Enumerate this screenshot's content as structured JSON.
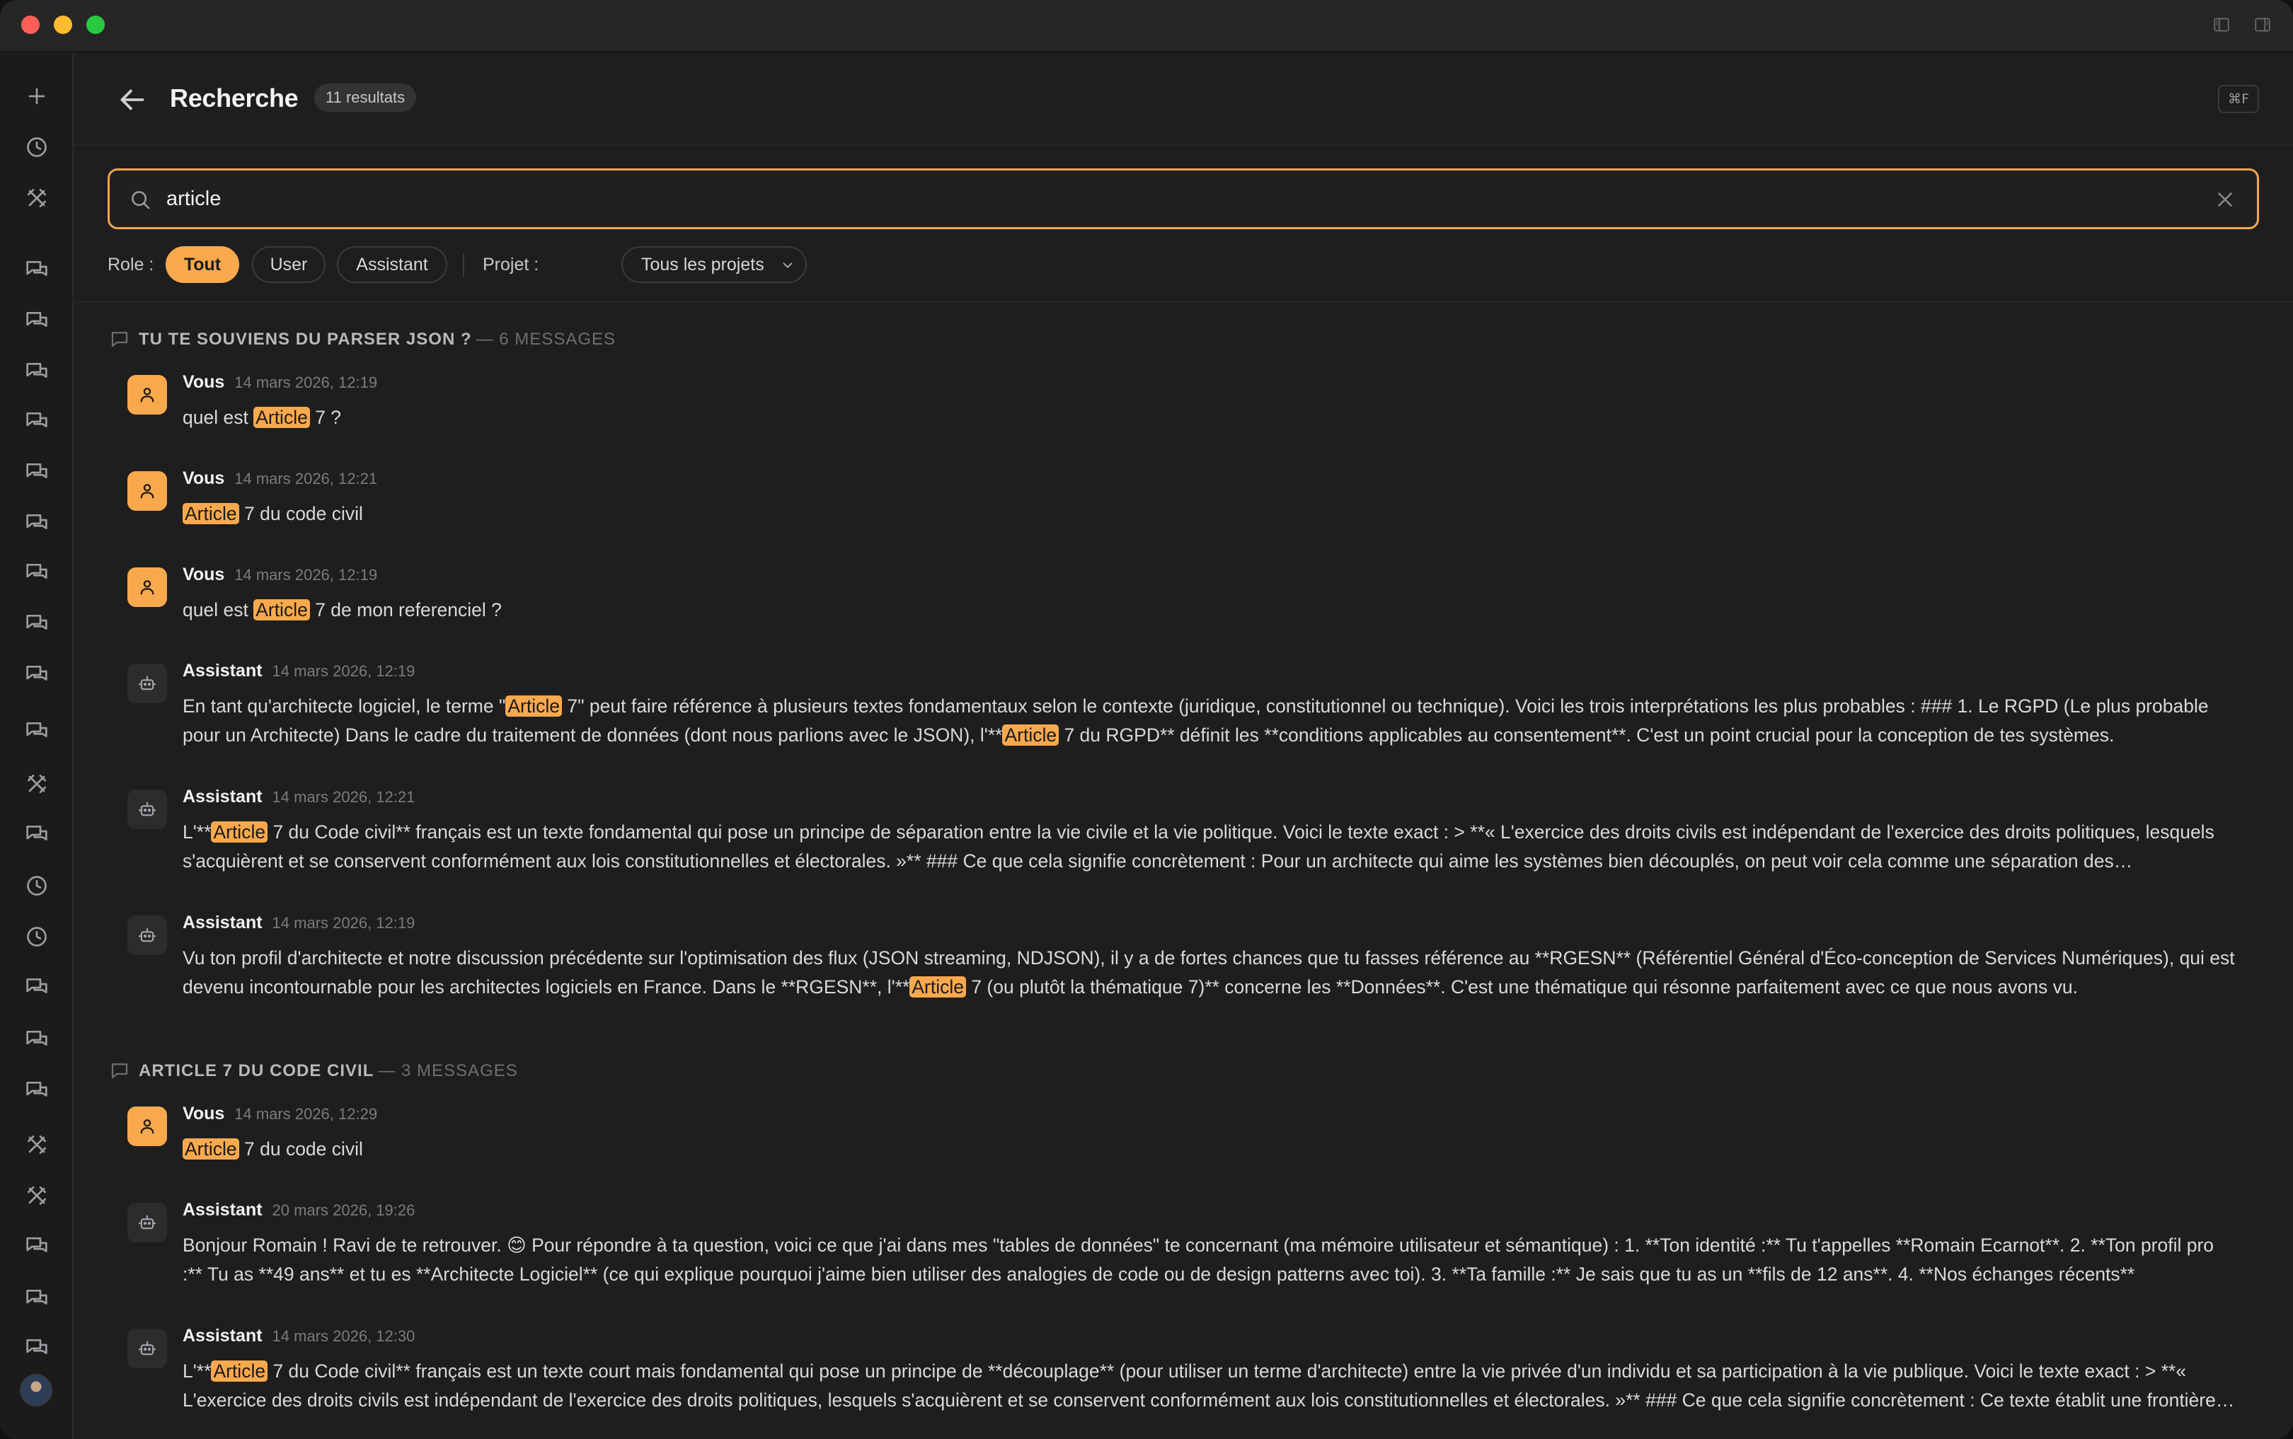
{
  "colors": {
    "accent": "#f8a94e",
    "background": "#1e1e1f",
    "highlight_text": "#1b1b1c"
  },
  "header": {
    "title": "Recherche",
    "result_count": "11 resultats",
    "shortcut": "⌘F"
  },
  "search": {
    "value": "article",
    "placeholder": ""
  },
  "filters": {
    "role_label": "Role :",
    "roles": [
      "Tout",
      "User",
      "Assistant"
    ],
    "active_role": "Tout",
    "project_label": "Projet :",
    "project_value": "Tous les projets"
  },
  "rail_icons": [
    "plus-icon",
    "clock-icon",
    "tools-icon",
    "chat-icon",
    "chat-icon",
    "chat-icon",
    "chat-icon",
    "chat-icon",
    "chat-icon",
    "chat-icon",
    "chat-icon",
    "chat-icon",
    "chat-icon",
    "tools-icon",
    "chat-icon",
    "clock-icon",
    "clock-icon",
    "chat-icon",
    "chat-icon",
    "chat-icon",
    "tools-icon",
    "tools-icon",
    "chat-icon",
    "chat-icon",
    "chat-icon"
  ],
  "groups": [
    {
      "title": "TU TE SOUVIENS DU PARSER JSON ?",
      "count": "— 6 MESSAGES",
      "messages": [
        {
          "role": "Vous",
          "date": "14 mars 2026, 12:19",
          "parts": [
            "quel est ",
            "Article",
            " 7 ?"
          ]
        },
        {
          "role": "Vous",
          "date": "14 mars 2026, 12:21",
          "parts": [
            "",
            "Article",
            " 7 du code civil"
          ]
        },
        {
          "role": "Vous",
          "date": "14 mars 2026, 12:19",
          "parts": [
            "quel est ",
            "Article",
            " 7 de mon referenciel ?"
          ]
        },
        {
          "role": "Assistant",
          "date": "14 mars 2026, 12:19",
          "parts": [
            "En tant qu'architecte logiciel, le terme \"",
            "Article",
            " 7\" peut faire référence à plusieurs textes fondamentaux selon le contexte (juridique, constitutionnel ou technique). Voici les trois interprétations les plus probables : ### 1. Le RGPD (Le plus probable pour un Architecte) Dans le cadre du traitement de données (dont nous parlions avec le JSON), l'**",
            "Article",
            " 7 du RGPD** définit les **conditions applicables au consentement**. C'est un point crucial pour la conception de tes systèmes."
          ]
        },
        {
          "role": "Assistant",
          "date": "14 mars 2026, 12:21",
          "parts": [
            "L'**",
            "Article",
            " 7 du Code civil** français est un texte fondamental qui pose un principe de séparation entre la vie civile et la vie politique. Voici le texte exact : > **« L'exercice des droits civils est indépendant de l'exercice des droits politiques, lesquels s'acquièrent et se conservent conformément aux lois constitutionnelles et électorales. »** ### Ce que cela signifie concrètement : Pour un architecte qui aime les systèmes bien découplés, on peut voir cela comme une séparation des responsabilités."
          ]
        },
        {
          "role": "Assistant",
          "date": "14 mars 2026, 12:19",
          "parts": [
            "Vu ton profil d'architecte et notre discussion précédente sur l'optimisation des flux (JSON streaming, NDJSON), il y a de fortes chances que tu fasses référence au **RGESN** (Référentiel Général d'Éco-conception de Services Numériques), qui est devenu incontournable pour les architectes logiciels en France. Dans le **RGESN**, l'**",
            "Article",
            " 7 (ou plutôt la thématique 7)** concerne les **Données**. C'est une thématique qui résonne parfaitement avec ce que nous avons vu."
          ]
        }
      ]
    },
    {
      "title": "ARTICLE 7 DU CODE CIVIL",
      "count": "— 3 MESSAGES",
      "messages": [
        {
          "role": "Vous",
          "date": "14 mars 2026, 12:29",
          "parts": [
            "",
            "Article",
            " 7 du code civil"
          ]
        },
        {
          "role": "Assistant",
          "date": "20 mars 2026, 19:26",
          "parts": [
            "Bonjour Romain ! Ravi de te retrouver. 😊 Pour répondre à ta question, voici ce que j'ai dans mes \"tables de données\" te concernant (ma mémoire utilisateur et sémantique) : 1. **Ton identité :** Tu t'appelles **Romain Ecarnot**. 2. **Ton profil pro :** Tu as **49 ans** et tu es **Architecte Logiciel** (ce qui explique pourquoi j'aime bien utiliser des analogies de code ou de design patterns avec toi). 3. **Ta famille :** Je sais que tu as un **fils de 12 ans**. 4. **Nos échanges récents**"
          ]
        },
        {
          "role": "Assistant",
          "date": "14 mars 2026, 12:30",
          "parts": [
            "L'**",
            "Article",
            " 7 du Code civil** français est un texte court mais fondamental qui pose un principe de **découplage** (pour utiliser un terme d'architecte) entre la vie privée d'un individu et sa participation à la vie publique. Voici le texte exact : > **« L'exercice des droits civils est indépendant de l'exercice des droits politiques, lesquels s'acquièrent et se conservent conformément aux lois constitutionnelles et électorales. »** ### Ce que cela signifie concrètement : Ce texte établit une frontière claire."
          ]
        }
      ]
    }
  ]
}
